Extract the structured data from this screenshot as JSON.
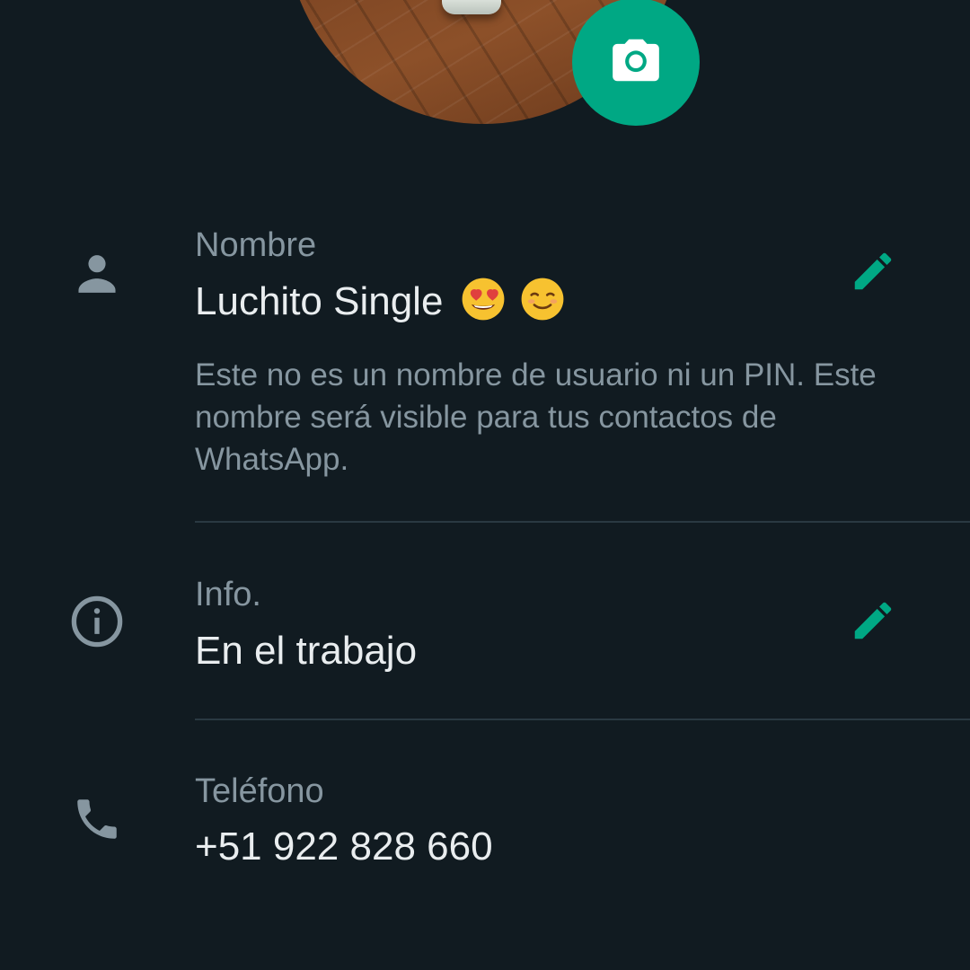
{
  "profile": {
    "photo_alt": "",
    "camera_icon": "camera-icon"
  },
  "name_section": {
    "label": "Nombre",
    "value": "Luchito Single",
    "emojis": [
      "smiling-face-with-heart-eyes",
      "smiling-face"
    ],
    "hint": "Este no es un nombre de usuario ni un PIN. Este nombre será visible para tus contactos de WhatsApp.",
    "icon": "person-icon",
    "edit_icon": "pencil-icon"
  },
  "info_section": {
    "label": "Info.",
    "value": "En el trabajo",
    "icon": "info-icon",
    "edit_icon": "pencil-icon"
  },
  "phone_section": {
    "label": "Teléfono",
    "value": "+51 922 828 660",
    "icon": "phone-icon"
  },
  "colors": {
    "background": "#111b21",
    "accent": "#00a884",
    "primary_text": "#e9edef",
    "secondary_text": "#8696a0",
    "divider": "#2a3942"
  }
}
